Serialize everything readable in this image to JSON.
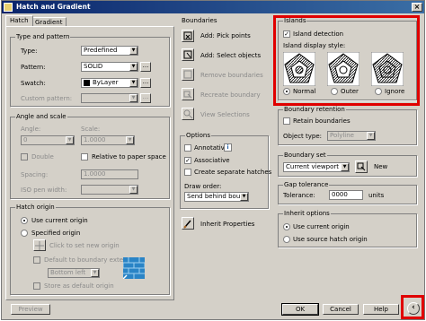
{
  "title": "Hatch and Gradient",
  "close_glyph": "×",
  "tabs": [
    "Hatch",
    "Gradient"
  ],
  "type_pattern": {
    "group": "Type and pattern",
    "type_label": "Type:",
    "type_value": "Predefined",
    "pattern_label": "Pattern:",
    "pattern_value": "SOLID",
    "swatch_label": "Swatch:",
    "swatch_value": "ByLayer",
    "custom_label": "Custom pattern:",
    "custom_value": ""
  },
  "angle_scale": {
    "group": "Angle and scale",
    "angle_label": "Angle:",
    "angle_value": "0",
    "scale_label": "Scale:",
    "scale_value": "1.0000",
    "double_label": "Double",
    "relative_label": "Relative to paper space",
    "spacing_label": "Spacing:",
    "spacing_value": "1.0000",
    "iso_label": "ISO pen width:",
    "iso_value": ""
  },
  "hatch_origin": {
    "group": "Hatch origin",
    "use_current": "Use current origin",
    "specified": "Specified origin",
    "click_set": "Click to set new origin",
    "default_extents": "Default to boundary extents",
    "position": "Bottom left",
    "store": "Store as default origin"
  },
  "boundaries": {
    "group": "Boundaries",
    "pick": "Add: Pick points",
    "select": "Add: Select objects",
    "remove": "Remove boundaries",
    "recreate": "Recreate boundary",
    "view": "View Selections"
  },
  "options": {
    "group": "Options",
    "annotative": "Annotative",
    "info_glyph": "i",
    "associative": "Associative",
    "separate": "Create separate hatches",
    "draw_order_label": "Draw order:",
    "draw_order_value": "Send behind boundary"
  },
  "inherit_label": "Inherit Properties",
  "islands": {
    "group": "Islands",
    "detection": "Island detection",
    "style_label": "Island display style:",
    "normal": "Normal",
    "outer": "Outer",
    "ignore": "Ignore"
  },
  "retention": {
    "group": "Boundary retention",
    "retain": "Retain boundaries",
    "object_type_label": "Object type:",
    "object_type_value": "Polyline"
  },
  "boundary_set": {
    "group": "Boundary set",
    "value": "Current viewport",
    "new_label": "New"
  },
  "gap": {
    "group": "Gap tolerance",
    "label": "Tolerance:",
    "value": "0000",
    "units": "units"
  },
  "inherit_options": {
    "group": "Inherit options",
    "current": "Use current origin",
    "source": "Use source hatch origin"
  },
  "footer": {
    "preview": "Preview",
    "ok": "OK",
    "cancel": "Cancel",
    "help": "Help",
    "more_glyph": "‹"
  },
  "check": "✓",
  "arrow": "▼",
  "browse": "...",
  "colors": {
    "highlight": "#e00000",
    "title_bar": "#0a246a",
    "dialog": "#d4d0c8"
  }
}
